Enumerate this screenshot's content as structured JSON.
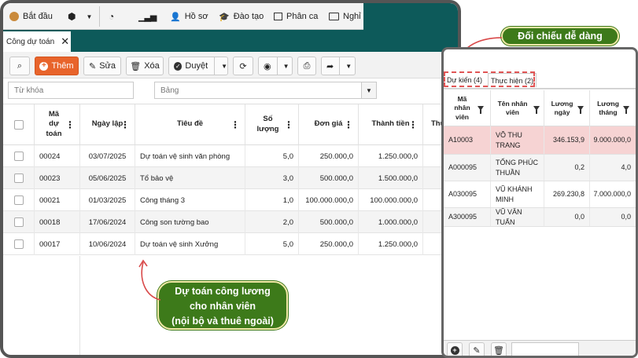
{
  "menu": {
    "start_label": "Bắt đầu",
    "profile_label": "Hồ sơ",
    "training_label": "Đào tạo",
    "assign_label": "Phân ca",
    "leave_label": "Nghỉ"
  },
  "tab": {
    "label": "Công dự toán"
  },
  "toolbar": {
    "add_label": "Thêm",
    "edit_label": "Sửa",
    "delete_label": "Xóa",
    "approve_label": "Duyệt"
  },
  "filters": {
    "keyword_placeholder": "Từ khóa",
    "table_placeholder": "Bảng"
  },
  "grid": {
    "headers": {
      "code": "Mã dự toán",
      "date": "Ngày lập",
      "title": "Tiêu đề",
      "qty": "Số lượng",
      "price": "Đơn giá",
      "amount": "Thành tiền",
      "extra": "Thứ"
    },
    "rows": [
      {
        "code": "00024",
        "date": "03/07/2025",
        "title": "Dự toán vệ sinh văn phòng",
        "qty": "5,0",
        "price": "250.000,0",
        "amount": "1.250.000,0"
      },
      {
        "code": "00023",
        "date": "05/06/2025",
        "title": "Tổ bảo vệ",
        "qty": "3,0",
        "price": "500.000,0",
        "amount": "1.500.000,0"
      },
      {
        "code": "00021",
        "date": "01/03/2025",
        "title": "Công tháng 3",
        "qty": "1,0",
        "price": "100.000.000,0",
        "amount": "100.000.000,0"
      },
      {
        "code": "00018",
        "date": "17/06/2024",
        "title": "Công son tường bao",
        "qty": "2,0",
        "price": "500.000,0",
        "amount": "1.000.000,0"
      },
      {
        "code": "00017",
        "date": "10/06/2024",
        "title": "Dự toán vệ sinh Xưởng",
        "qty": "5,0",
        "price": "250.000,0",
        "amount": "1.250.000,0"
      }
    ]
  },
  "callouts": {
    "compare": "Đối chiếu dễ dàng",
    "estimate_line1": "Dự toán công lương",
    "estimate_line2": "cho nhân viên",
    "estimate_line3": "(nội bộ và thuê ngoài)"
  },
  "panel": {
    "tab_planned": "Dự kiến (4)",
    "tab_actual": "Thực hiện (2)",
    "headers": {
      "code": "Mã nhân viên",
      "name": "Tên nhân viên",
      "daily": "Lương ngày",
      "monthly": "Lương tháng"
    },
    "rows": [
      {
        "code": "A10003",
        "name": "VÕ THU TRANG",
        "daily": "346.153,9",
        "monthly": "9.000.000,0"
      },
      {
        "code": "A000095",
        "name": "TỐNG PHÚC THUẦN",
        "daily": "0,2",
        "monthly": "4,0"
      },
      {
        "code": "A030095",
        "name": "VŨ KHÁNH MINH",
        "daily": "269.230,8",
        "monthly": "7.000.000,0"
      },
      {
        "code": "A300095",
        "name": "VŨ VĂN TUẤN",
        "daily": "0,0",
        "monthly": "0,0"
      }
    ]
  },
  "colors": {
    "teal": "#0d5a5a",
    "accent": "#e8642b",
    "callout": "#3d7a1a",
    "highlight_row": "#f6d3d3"
  }
}
